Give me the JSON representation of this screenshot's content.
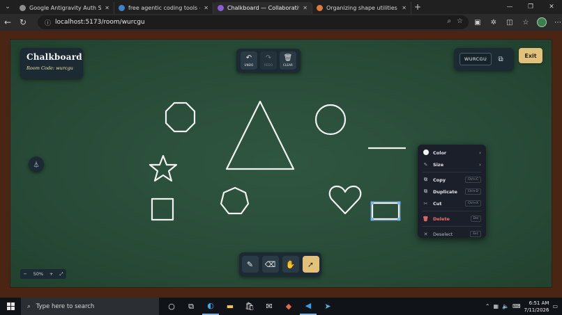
{
  "browser": {
    "tabs": [
      {
        "label": "Google Antigravity Auth Success",
        "color": "#8f8f8f",
        "active": false
      },
      {
        "label": "free agentic coding tools - Search",
        "color": "#3c83c9",
        "active": false
      },
      {
        "label": "Chalkboard — Collaborative Real",
        "color": "#8b5cd6",
        "active": true
      },
      {
        "label": "Organizing shape utilities across",
        "color": "#e07a3c",
        "active": false
      }
    ],
    "url": "localhost:5173/room/wurcgu"
  },
  "app": {
    "title": "Chalkboard",
    "room_code_label": "Room Code: wurcgu",
    "room_code": "WURCGU",
    "exit_label": "Exit",
    "history": {
      "undo": "UNDO",
      "redo": "REDO",
      "clear": "CLEAR"
    },
    "zoom": {
      "minus": "−",
      "value": "50%",
      "plus": "+"
    }
  },
  "context_menu": {
    "color": "Color",
    "size": "Size",
    "copy": "Copy",
    "copy_key": "Ctrl+C",
    "duplicate": "Duplicate",
    "duplicate_key": "Ctrl+D",
    "cut": "Cut",
    "cut_key": "Ctrl+X",
    "delete": "Delete",
    "delete_key": "Del",
    "deselect": "Deselect",
    "deselect_key": "Esc"
  },
  "colors": {
    "board": "#284b38",
    "frame": "#4b2514",
    "accent": "#e2c27b",
    "chalk": "#f2f2f2",
    "selection": "#7ab4f5"
  },
  "taskbar": {
    "search_placeholder": "Type here to search",
    "time": "6:51 AM",
    "date": "7/11/2026"
  }
}
